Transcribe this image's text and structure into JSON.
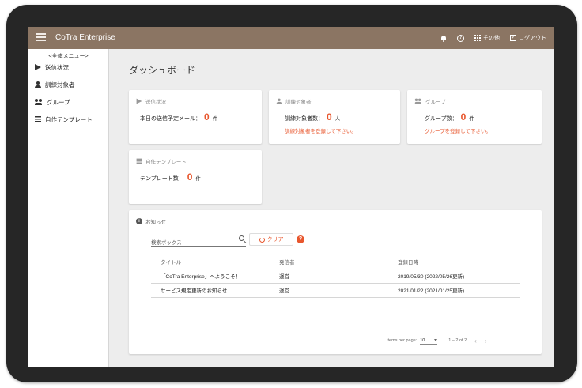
{
  "app": {
    "title": "CoTra Enterprise"
  },
  "topbar": {
    "other_label": "その他",
    "logout_label": "ログアウト",
    "help_glyph": "?"
  },
  "sidebar": {
    "header": "<全体メニュー>",
    "items": [
      {
        "label": "送信状況",
        "icon": "send-icon"
      },
      {
        "label": "訓練対象者",
        "icon": "person-icon"
      },
      {
        "label": "グループ",
        "icon": "group-icon"
      },
      {
        "label": "自作テンプレート",
        "icon": "list-icon"
      }
    ]
  },
  "page": {
    "title": "ダッシュボード"
  },
  "cards": {
    "send": {
      "title": "送信状況",
      "label": "本日の送信予定メール：",
      "value": "0",
      "unit": "件"
    },
    "targets": {
      "title": "訓練対象者",
      "label": "訓練対象者数：",
      "value": "0",
      "unit": "人",
      "warning": "訓練対象者を登録して下さい。"
    },
    "groups": {
      "title": "グループ",
      "label": "グループ数：",
      "value": "0",
      "unit": "件",
      "warning": "グループを登録して下さい。"
    },
    "templates": {
      "title": "自作テンプレート",
      "label": "テンプレート数：",
      "value": "0",
      "unit": "件"
    }
  },
  "notices": {
    "title": "お知らせ",
    "info_glyph": "i",
    "search_placeholder": "検索ボックス",
    "clear_label": "クリア",
    "help_glyph": "?",
    "columns": [
      "タイトル",
      "発信者",
      "登録日時"
    ],
    "rows": [
      {
        "title": "「CoTra Enterprise」へようこそ！",
        "sender": "運営",
        "date": "2019/05/30 (2022/05/26更新)"
      },
      {
        "title": "サービス規定更新のお知らせ",
        "sender": "運営",
        "date": "2021/01/22 (2021/01/25更新)"
      }
    ],
    "pager": {
      "items_per_page_label": "Items per page:",
      "page_size": "10",
      "range": "1 – 2 of 2",
      "prev": "‹",
      "next": "›"
    }
  },
  "colors": {
    "accent": "#e8562d",
    "topbar": "#8b7563",
    "bezel": "#262626"
  }
}
